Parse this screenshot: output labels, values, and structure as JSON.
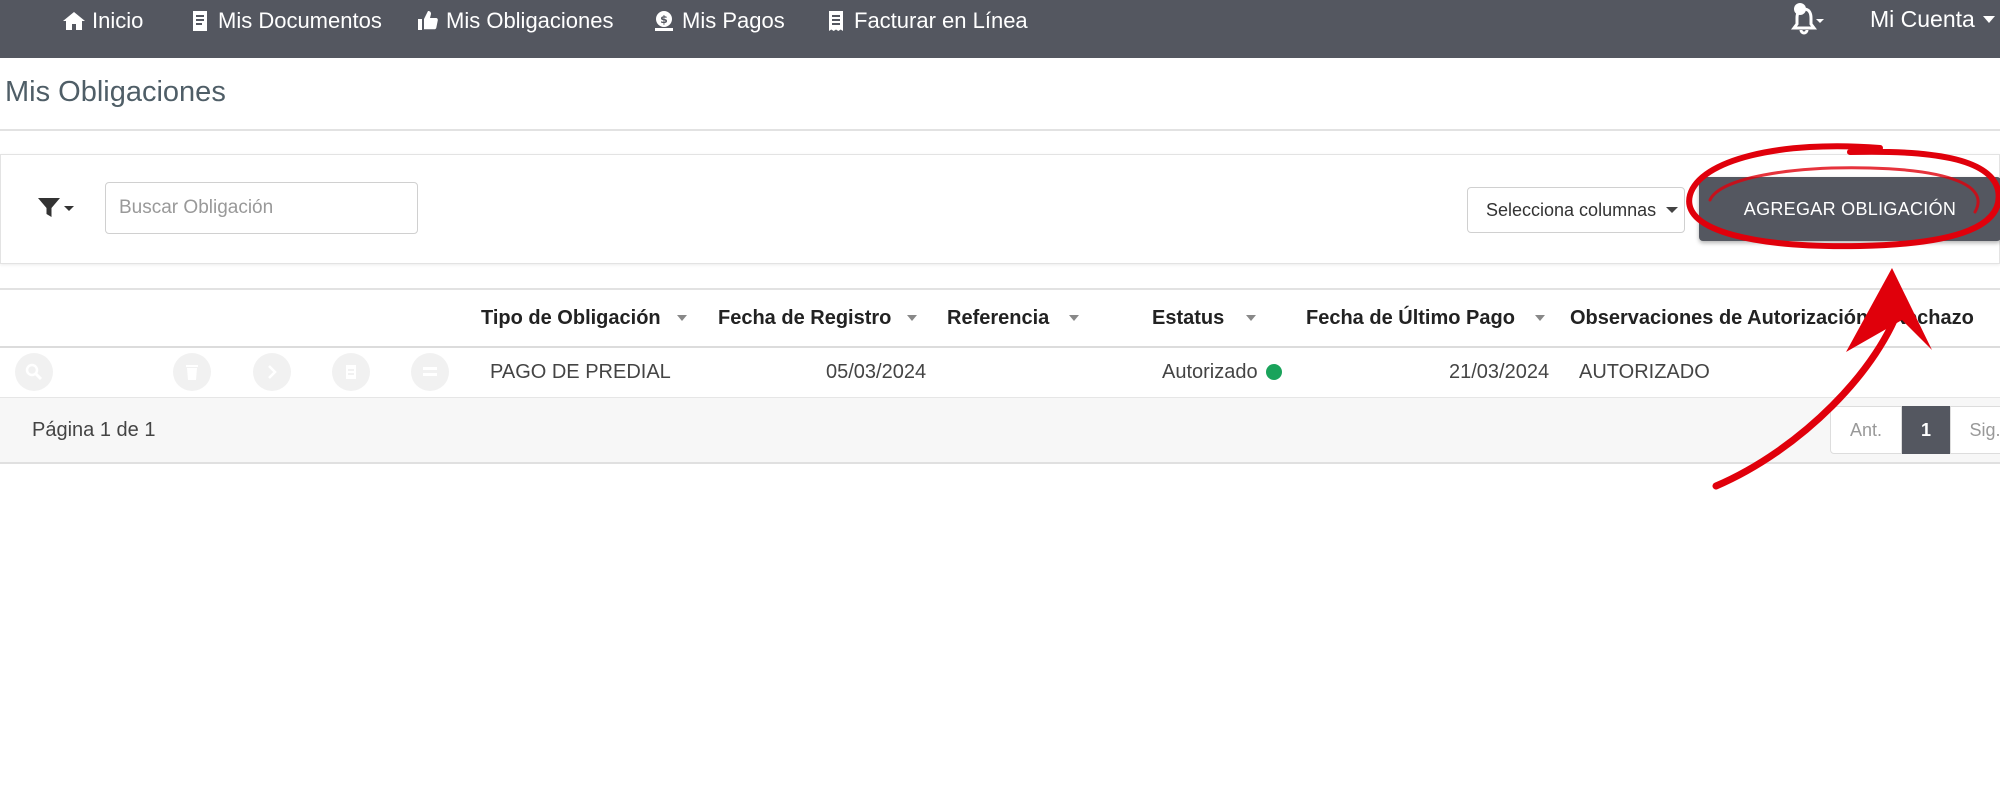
{
  "nav": {
    "items": [
      {
        "label": "Inicio",
        "icon": "home-icon"
      },
      {
        "label": "Mis Documentos",
        "icon": "document-icon"
      },
      {
        "label": "Mis Obligaciones",
        "icon": "thumbs-up-icon"
      },
      {
        "label": "Mis Pagos",
        "icon": "money-icon"
      },
      {
        "label": "Facturar en Línea",
        "icon": "receipt-icon"
      }
    ],
    "account_label": "Mi Cuenta",
    "bell_icon": "bell-icon"
  },
  "page": {
    "title": "Mis Obligaciones"
  },
  "toolbar": {
    "filter_icon": "filter-icon",
    "search_placeholder": "Buscar Obligación",
    "columns_label": "Selecciona columnas",
    "add_label": "AGREGAR OBLIGACIÓN"
  },
  "table": {
    "columns": [
      "Tipo de Obligación",
      "Fecha de Registro",
      "Referencia",
      "Estatus",
      "Fecha de Último Pago",
      "Observaciones de Autorización o Rechazo"
    ],
    "row_actions": [
      "view-icon",
      "delete-icon",
      "next-icon",
      "print-icon",
      "details-icon"
    ],
    "rows": [
      {
        "tipo": "PAGO DE PREDIAL",
        "fecha_registro": "05/03/2024",
        "referencia": "",
        "estatus": "Autorizado",
        "fecha_ultimo_pago": "21/03/2024",
        "observaciones": "AUTORIZADO"
      }
    ]
  },
  "pagination": {
    "info": "Página 1 de 1",
    "prev_label": "Ant.",
    "current": "1",
    "next_label": "Sig."
  },
  "colors": {
    "navbar": "#545760",
    "status_ok": "#1aa35b",
    "annotation": "#e0000b"
  }
}
